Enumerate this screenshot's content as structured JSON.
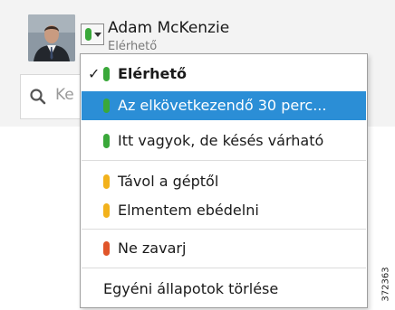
{
  "user": {
    "name": "Adam McKenzie",
    "status": "Elérhető"
  },
  "search": {
    "placeholder": "Ke"
  },
  "status_menu": {
    "items": [
      {
        "label": "Elérhető",
        "color": "#3aa83a",
        "checked": true,
        "bold": true
      },
      {
        "label": "Az elkövetkezendő 30 perc...",
        "color": "#3aa83a",
        "highlighted": true
      },
      {
        "label": "Itt vagyok, de késés várható",
        "color": "#3aa83a"
      },
      {
        "label": "Távol a géptől",
        "color": "#f2b21c"
      },
      {
        "label": "Elmentem ebédelni",
        "color": "#f2b21c"
      },
      {
        "label": "Ne zavarj",
        "color": "#e0552a"
      }
    ],
    "check_mark": "✓",
    "clear_label": "Egyéni állapotok törlése"
  },
  "figure_id": "372363",
  "colors": {
    "available": "#3aa83a",
    "away": "#f2b21c",
    "busy": "#e0552a",
    "highlight": "#2b8ed6"
  }
}
